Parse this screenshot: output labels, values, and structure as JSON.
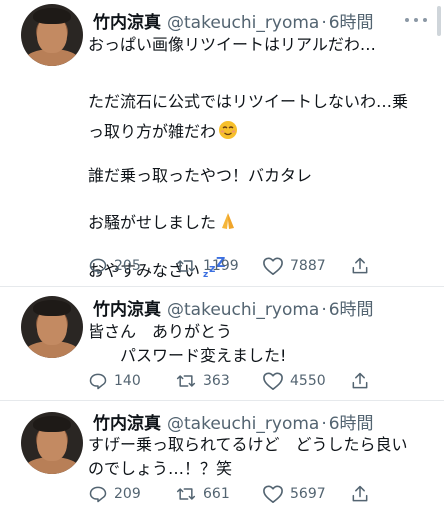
{
  "tweets": [
    {
      "name": "竹内涼真",
      "handle": "@takeuchi_ryoma",
      "separator": "·",
      "time": "6時間",
      "lines": [
        "おっぱい画像リツイートはリアルだわ…",
        "",
        "ただ流石に公式ではリツイートしないわ…乗",
        "っ取り方が雑だわ",
        "",
        "誰だ乗っ取ったやつ！バカタレ",
        "",
        "お騒がせしました",
        "",
        "おやすみなさい"
      ],
      "replies": "205",
      "retweets": "1199",
      "likes": "7887"
    },
    {
      "name": "竹内涼真",
      "handle": "@takeuchi_ryoma",
      "separator": "·",
      "time": "6時間",
      "lines": [
        "皆さん　ありがとう",
        "　　パスワード変えました!"
      ],
      "replies": "140",
      "retweets": "363",
      "likes": "4550"
    },
    {
      "name": "竹内涼真",
      "handle": "@takeuchi_ryoma",
      "separator": "·",
      "time": "6時間",
      "lines": [
        "すげー乗っ取られてるけど　どうしたら良い",
        "のでしょう…！？笑"
      ],
      "replies": "209",
      "retweets": "661",
      "likes": "5697"
    }
  ],
  "icons": {
    "reply": "reply-icon",
    "retweet": "retweet-icon",
    "like": "heart-icon",
    "share": "share-icon",
    "more": "more-icon",
    "relieved_emoji": "relieved-face-emoji",
    "pray_emoji": "folded-hands-emoji",
    "sleep_emoji": "zzz-emoji"
  },
  "colors": {
    "text": "#0f1419",
    "secondary": "#536471",
    "divider": "#e6e9ec",
    "zzz": "#3b6fe0"
  }
}
